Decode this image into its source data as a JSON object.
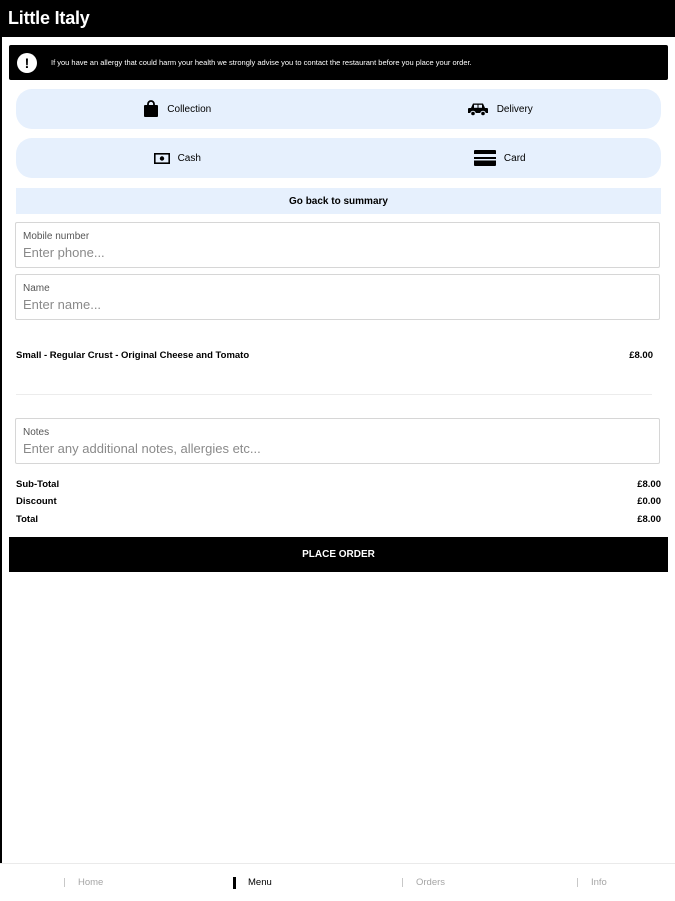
{
  "app": {
    "title": "Little Italy"
  },
  "allergy_notice": {
    "text": "If you have an allergy that could harm your health we strongly advise you to contact the restaurant before you place your order.",
    "icon": "info-icon"
  },
  "fulfilment": {
    "collection": "Collection",
    "delivery": "Delivery"
  },
  "payment": {
    "cash": "Cash",
    "card": "Card"
  },
  "back_label": "Go back to summary",
  "form": {
    "mobile": {
      "label": "Mobile number",
      "placeholder": "Enter phone..."
    },
    "name": {
      "label": "Name",
      "placeholder": "Enter name..."
    },
    "notes": {
      "label": "Notes",
      "placeholder": "Enter any additional notes, allergies etc..."
    }
  },
  "order": {
    "items": [
      {
        "name": "Small - Regular Crust - Original Cheese and Tomato",
        "price": "£8.00"
      }
    ]
  },
  "totals": {
    "subtotal_label": "Sub-Total",
    "subtotal": "£8.00",
    "discount_label": "Discount",
    "discount": "£0.00",
    "total_label": "Total",
    "total": "£8.00"
  },
  "place_order_label": "PLACE ORDER",
  "nav": {
    "home": "Home",
    "menu": "Menu",
    "orders": "Orders",
    "info": "Info",
    "active": "Menu"
  },
  "colors": {
    "accent_light": "#e6f0fd",
    "primary": "#000000"
  }
}
